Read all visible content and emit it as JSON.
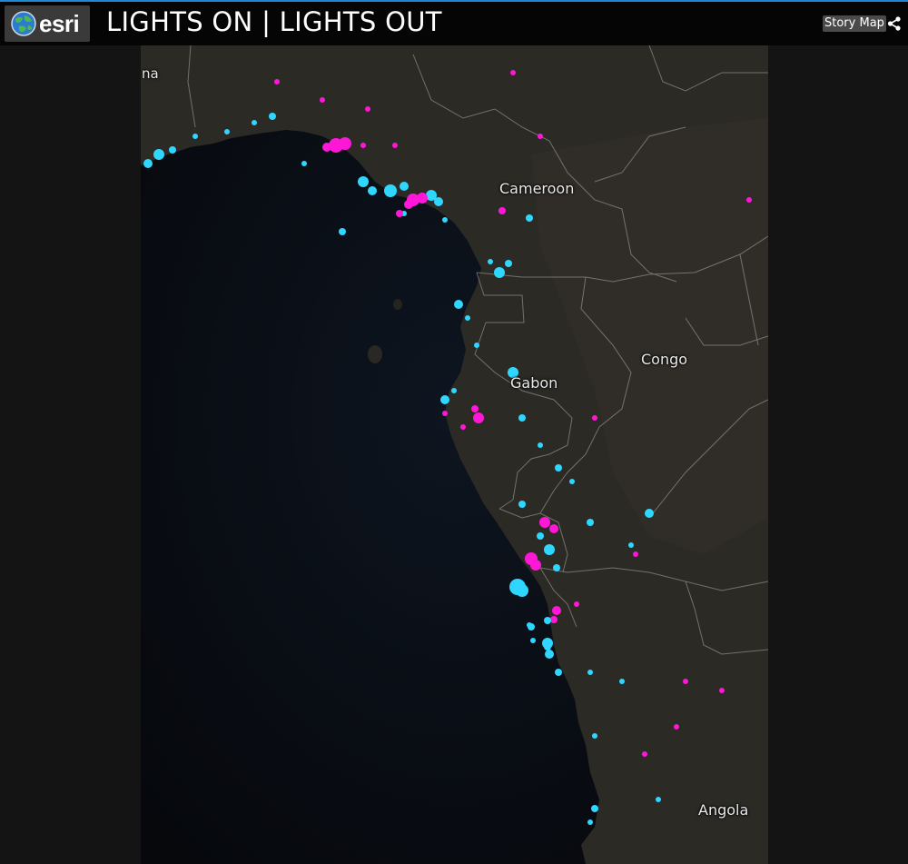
{
  "header": {
    "logo_text": "esri",
    "title": "LIGHTS ON | LIGHTS OUT",
    "story_map_label": "Story Map"
  },
  "map": {
    "labels": {
      "cameroon": "Cameroon",
      "congo": "Congo",
      "gabon": "Gabon",
      "angola": "Angola",
      "partial_top_left": "na"
    },
    "legend_colors": {
      "lights_on": "#ff17d8",
      "lights_out": "#2fd6ff"
    },
    "colors": {
      "ocean": "#0c1119",
      "land": "#2a2a26",
      "border": "#8a8a8a"
    }
  }
}
